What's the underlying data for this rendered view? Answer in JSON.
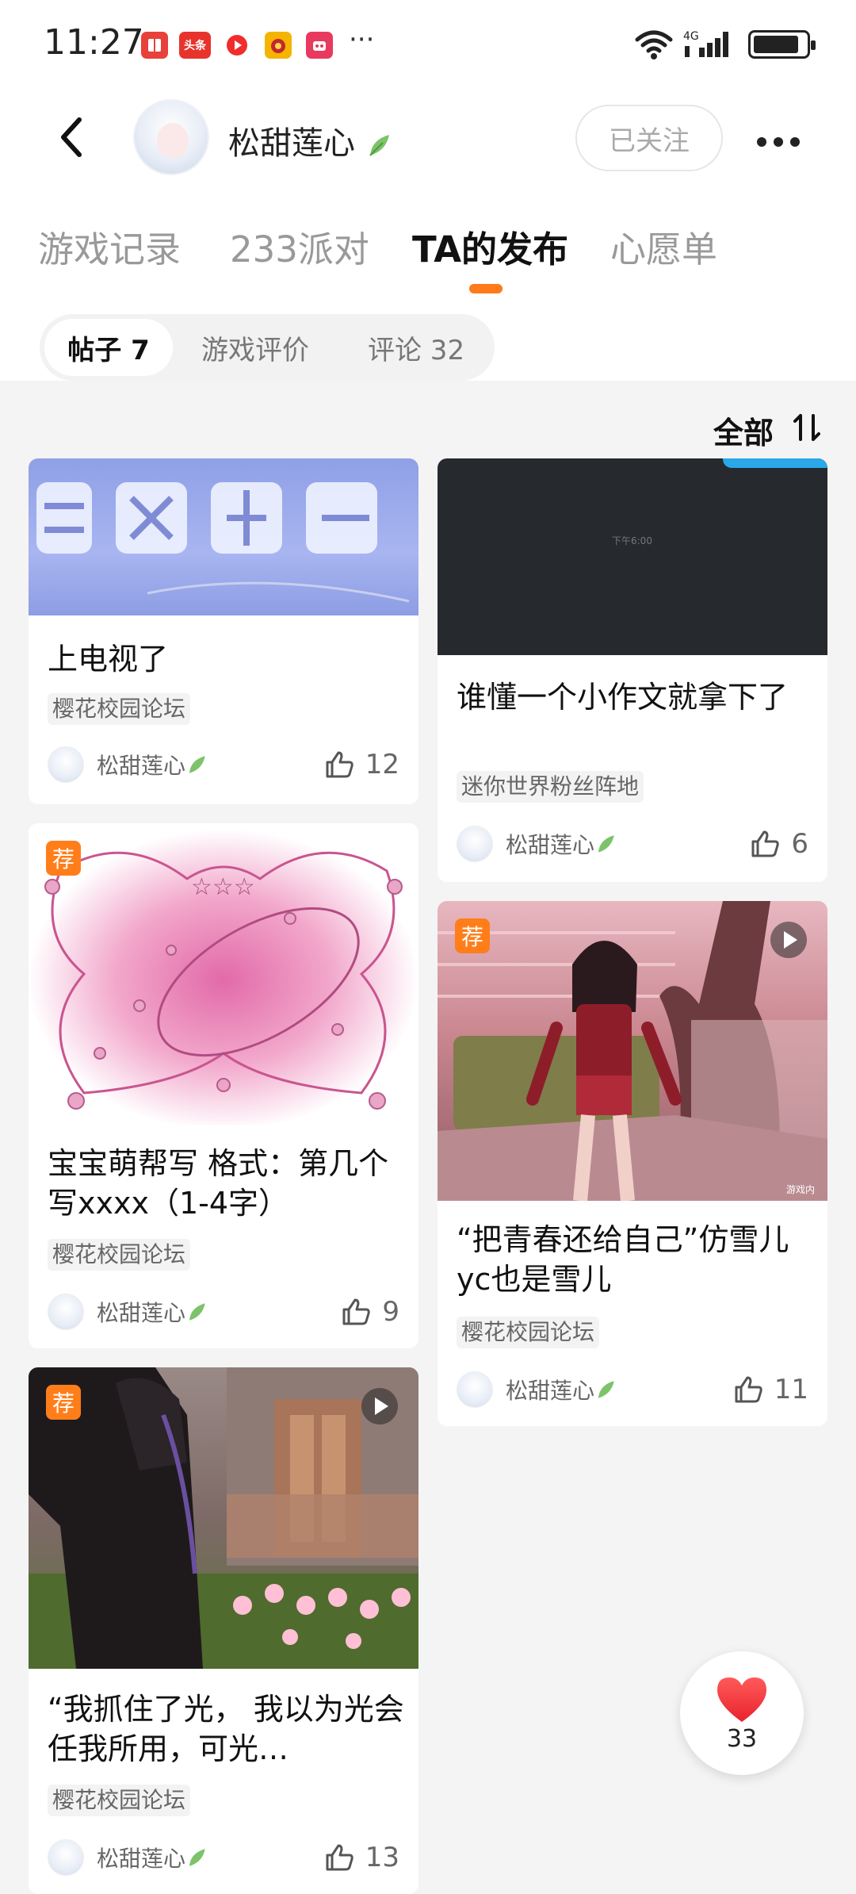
{
  "status_bar": {
    "time": "11:27",
    "app_icons": [
      {
        "name": "book-app-icon",
        "label": "",
        "color": "#e8403a"
      },
      {
        "name": "toutiao-app-icon",
        "label": "头条",
        "color": "#e7332b"
      },
      {
        "name": "video-app-icon",
        "label": "",
        "color": "#f12c2c"
      },
      {
        "name": "game-app-icon",
        "label": "",
        "color": "#f4b400"
      },
      {
        "name": "shop-app-icon",
        "label": "",
        "color": "#e83a5e"
      }
    ],
    "more_dots": "···",
    "network": "4G"
  },
  "header": {
    "username": "松甜莲心",
    "follow_label": "已关注"
  },
  "tabs": [
    {
      "label": "游戏记录",
      "active": false
    },
    {
      "label": "233派对",
      "active": false
    },
    {
      "label": "TA的发布",
      "active": true
    },
    {
      "label": "心愿单",
      "active": false
    }
  ],
  "segments": [
    {
      "label": "帖子 7",
      "active": true
    },
    {
      "label": "游戏评价",
      "active": false
    },
    {
      "label": "评论 32",
      "active": false
    }
  ],
  "sort_label": "全部",
  "colors": {
    "accent": "#ff7a1a",
    "badge": "#ff7e1a"
  },
  "cards": [
    {
      "title": "上电视了",
      "tag": "樱花校园论坛",
      "author": "松甜莲心",
      "likes": "12",
      "badge": "",
      "video": false
    },
    {
      "title": "谁懂一个小作文就拿下了",
      "tag": "迷你世界粉丝阵地",
      "author": "松甜莲心",
      "likes": "6",
      "badge": "",
      "video": false,
      "image_text": "下午6:00"
    },
    {
      "title": "宝宝萌帮写 格式：第几个 写xxxx（1-4字）",
      "tag": "樱花校园论坛",
      "author": "松甜莲心",
      "likes": "9",
      "badge": "荐",
      "video": false
    },
    {
      "title": "“把青春还给自己”仿雪儿 yc也是雪儿",
      "tag": "樱花校园论坛",
      "author": "松甜莲心",
      "likes": "11",
      "badge": "荐",
      "video": true,
      "image_text": "游戏内"
    },
    {
      "title": "“我抓住了光， 我以为光会任我所用，可光…",
      "tag": "樱花校园论坛",
      "author": "松甜莲心",
      "likes": "13",
      "badge": "荐",
      "video": true
    }
  ],
  "fab": {
    "count": "33"
  }
}
